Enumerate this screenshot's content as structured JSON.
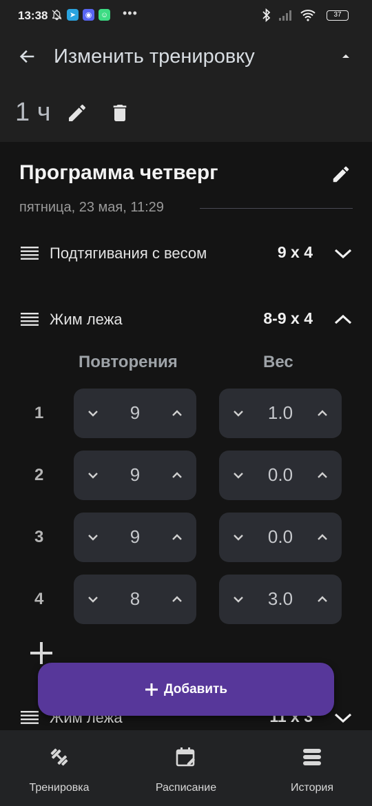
{
  "status_bar": {
    "time": "13:38",
    "battery": "37"
  },
  "header": {
    "title": "Изменить тренировку",
    "duration": "1 ч"
  },
  "program": {
    "title": "Программа четверг",
    "date": "пятница, 23 мая, 11:29"
  },
  "exercises": [
    {
      "name": "Подтягивания с весом",
      "sets": "9 x 4",
      "expanded": false
    },
    {
      "name": "Жим лежа",
      "sets": "8-9 x 4",
      "expanded": true
    },
    {
      "name": "Жим лежа",
      "sets": "11 x 3",
      "expanded": false
    }
  ],
  "set_table": {
    "col_reps": "Повторения",
    "col_weight": "Вес",
    "rows": [
      {
        "num": "1",
        "reps": "9",
        "weight": "1.0"
      },
      {
        "num": "2",
        "reps": "9",
        "weight": "0.0"
      },
      {
        "num": "3",
        "reps": "9",
        "weight": "0.0"
      },
      {
        "num": "4",
        "reps": "8",
        "weight": "3.0"
      }
    ]
  },
  "fab": {
    "label": "Добавить"
  },
  "nav": {
    "items": [
      {
        "label": "Тренировка",
        "icon": "dumbbell-icon"
      },
      {
        "label": "Расписание",
        "icon": "calendar-edit-icon"
      },
      {
        "label": "История",
        "icon": "stack-icon"
      }
    ]
  },
  "colors": {
    "accent": "#57379a",
    "background": "#141414",
    "surface": "#2b2d33",
    "bar": "#202020"
  }
}
